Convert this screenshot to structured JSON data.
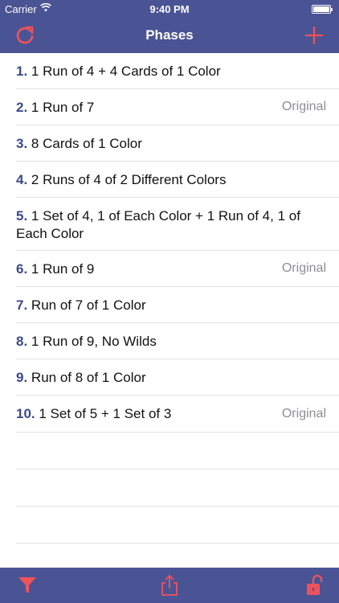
{
  "status_bar": {
    "carrier": "Carrier",
    "time": "9:40 PM",
    "battery_level": 1.0
  },
  "nav": {
    "title": "Phases",
    "left_icon": "refresh-icon",
    "right_icon": "plus-icon"
  },
  "phases": [
    {
      "number": "1.",
      "text": "1 Run of 4 + 4 Cards of 1 Color",
      "tag": ""
    },
    {
      "number": "2.",
      "text": "1 Run of 7",
      "tag": "Original"
    },
    {
      "number": "3.",
      "text": "8 Cards of 1 Color",
      "tag": ""
    },
    {
      "number": "4.",
      "text": "2 Runs of 4 of 2 Different Colors",
      "tag": ""
    },
    {
      "number": "5.",
      "text": "1 Set of 4, 1 of Each Color + 1 Run of 4, 1 of Each Color",
      "tag": ""
    },
    {
      "number": "6.",
      "text": "1 Run of 9",
      "tag": "Original"
    },
    {
      "number": "7.",
      "text": "Run of 7 of 1 Color",
      "tag": ""
    },
    {
      "number": "8.",
      "text": "1 Run of 9, No Wilds",
      "tag": ""
    },
    {
      "number": "9.",
      "text": "Run of 8 of 1 Color",
      "tag": ""
    },
    {
      "number": "10.",
      "text": "1 Set of 5 + 1 Set of 3",
      "tag": "Original"
    }
  ],
  "toolbar": {
    "left_icon": "filter-icon",
    "center_icon": "share-icon",
    "right_icon": "unlock-icon"
  },
  "colors": {
    "bar": "#4a5494",
    "accent": "#f0525a",
    "number": "#3a4a8c",
    "tag": "#8e8e93"
  }
}
